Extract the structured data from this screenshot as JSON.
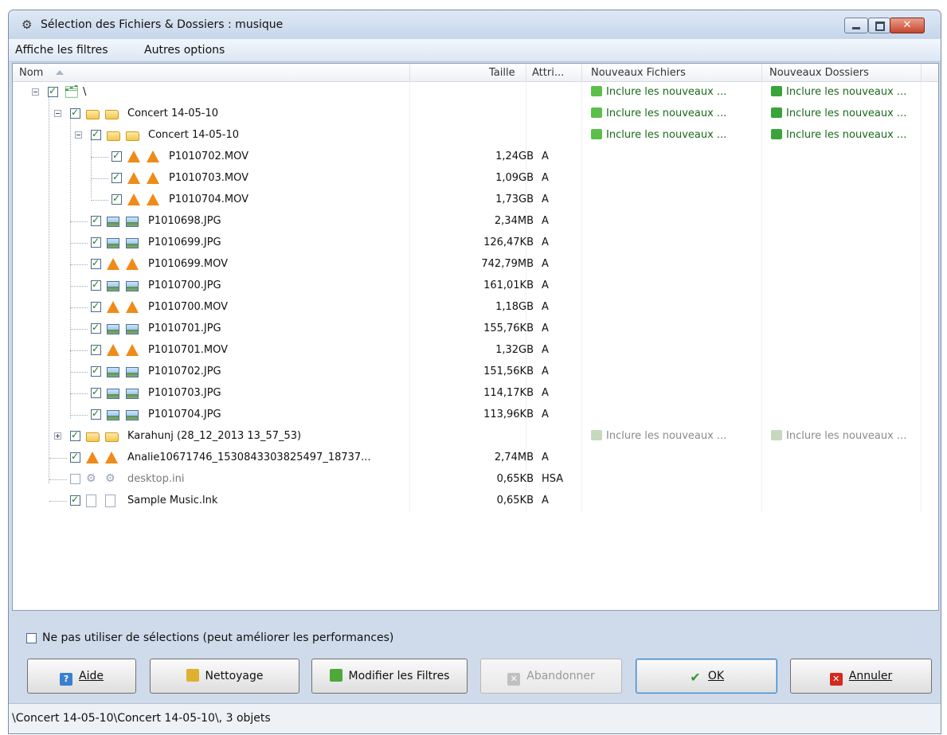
{
  "window": {
    "title": "Sélection des Fichiers & Dossiers : musique",
    "controls": {
      "minimize_icon": "minimize-icon",
      "maximize_icon": "maximize-icon",
      "close_icon": "close-icon",
      "close_color": "#c8452e"
    }
  },
  "menu": {
    "items": [
      "Affiche les filtres",
      "Autres options"
    ]
  },
  "columns": {
    "name": "Nom",
    "size": "Taille",
    "attr": "Attri...",
    "new_files": "Nouveaux Fichiers",
    "new_folders": "Nouveaux Dossiers"
  },
  "rows": [
    {
      "name": "\\",
      "size": "",
      "attr": "",
      "rule_files": "Inclure les nouveaux ...",
      "rule_folders": "Inclure les nouveaux ...",
      "icon": "network-folder-icon"
    },
    {
      "name": "Concert 14-05-10",
      "size": "",
      "attr": "",
      "rule_files": "Inclure les nouveaux ...",
      "rule_folders": "Inclure les nouveaux ...",
      "icon": "folder-icon"
    },
    {
      "name": "Concert 14-05-10",
      "size": "",
      "attr": "",
      "rule_files": "Inclure les nouveaux ...",
      "rule_folders": "Inclure les nouveaux ...",
      "icon": "folder-icon"
    },
    {
      "name": "P1010702.MOV",
      "size": "1,24GB",
      "attr": "A",
      "icon": "vlc-cone-icon"
    },
    {
      "name": "P1010703.MOV",
      "size": "1,09GB",
      "attr": "A",
      "icon": "vlc-cone-icon"
    },
    {
      "name": "P1010704.MOV",
      "size": "1,73GB",
      "attr": "A",
      "icon": "vlc-cone-icon"
    },
    {
      "name": "P1010698.JPG",
      "size": "2,34MB",
      "attr": "A",
      "icon": "image-icon"
    },
    {
      "name": "P1010699.JPG",
      "size": "126,47KB",
      "attr": "A",
      "icon": "image-icon"
    },
    {
      "name": "P1010699.MOV",
      "size": "742,79MB",
      "attr": "A",
      "icon": "vlc-cone-icon"
    },
    {
      "name": "P1010700.JPG",
      "size": "161,01KB",
      "attr": "A",
      "icon": "image-icon"
    },
    {
      "name": "P1010700.MOV",
      "size": "1,18GB",
      "attr": "A",
      "icon": "vlc-cone-icon"
    },
    {
      "name": "P1010701.JPG",
      "size": "155,76KB",
      "attr": "A",
      "icon": "image-icon"
    },
    {
      "name": "P1010701.MOV",
      "size": "1,32GB",
      "attr": "A",
      "icon": "vlc-cone-icon"
    },
    {
      "name": "P1010702.JPG",
      "size": "151,56KB",
      "attr": "A",
      "icon": "image-icon"
    },
    {
      "name": "P1010703.JPG",
      "size": "114,17KB",
      "attr": "A",
      "icon": "image-icon"
    },
    {
      "name": "P1010704.JPG",
      "size": "113,96KB",
      "attr": "A",
      "icon": "image-icon"
    },
    {
      "name": "Karahunj (28_12_2013 13_57_53)",
      "size": "",
      "attr": "",
      "rule_files": "Inclure les nouveaux ...",
      "rule_folders": "Inclure les nouveaux ...",
      "icon": "folder-icon"
    },
    {
      "name": "Analie10671746_1530843303825497_18737...",
      "size": "2,74MB",
      "attr": "A",
      "icon": "vlc-cone-icon"
    },
    {
      "name": "desktop.ini",
      "size": "0,65KB",
      "attr": "HSA",
      "icon": "settings-file-icon"
    },
    {
      "name": "Sample Music.lnk",
      "size": "0,65KB",
      "attr": "A",
      "icon": "document-icon"
    }
  ],
  "options": {
    "no_selection_label": "Ne pas utiliser de sélections (peut améliorer les performances)"
  },
  "buttons": {
    "help": "Aide",
    "cleanup": "Nettoyage",
    "filters": "Modifier les Filtres",
    "abort": "Abandonner",
    "ok": "OK",
    "cancel": "Annuler"
  },
  "status": {
    "text": "\\Concert 14-05-10\\Concert 14-05-10\\, 3 objets"
  },
  "colors": {
    "rule_green": "#1a6a1a",
    "window_frame": "#cfdbea"
  }
}
